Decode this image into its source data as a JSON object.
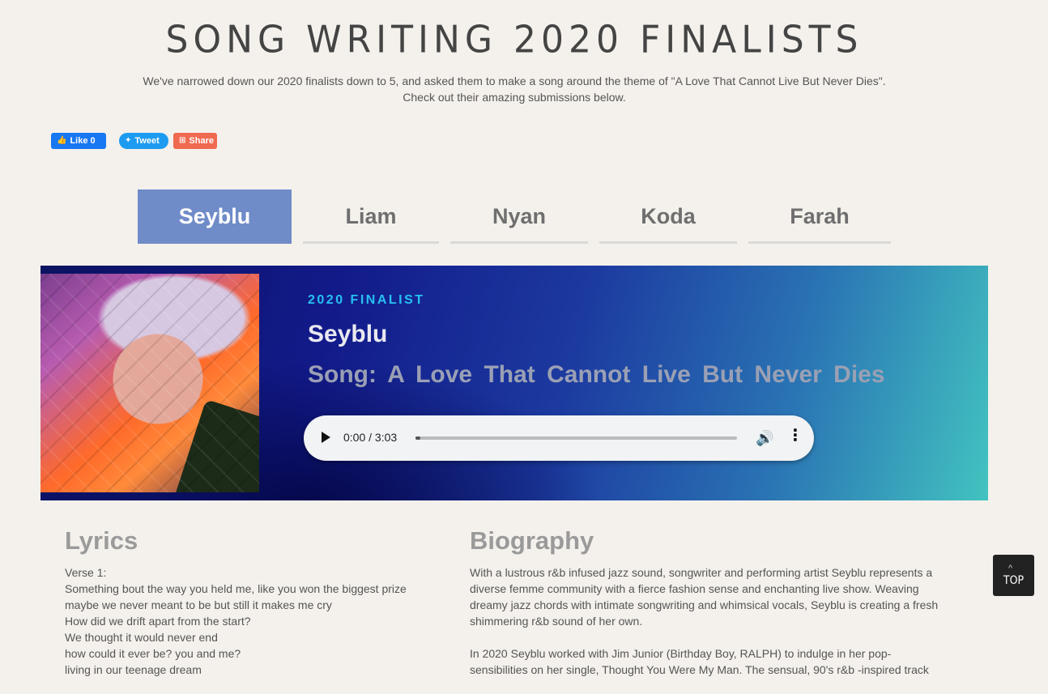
{
  "header": {
    "title": "SONG WRITING 2020 FINALISTS",
    "intro_line1": "We've narrowed down our 2020 finalists down to 5, and asked them to make a song around the theme of \"A Love That Cannot Live But Never Dies\".",
    "intro_line2": "Check out their amazing submissions below."
  },
  "social": {
    "like_label": "Like 0",
    "tweet_label": "Tweet",
    "share_label": "Share",
    "colors": {
      "facebook": "#1877f2",
      "twitter": "#1d9bf0",
      "share": "#f06a50"
    }
  },
  "tabs": [
    {
      "label": "Seyblu",
      "active": true
    },
    {
      "label": "Liam",
      "active": false
    },
    {
      "label": "Nyan",
      "active": false
    },
    {
      "label": "Koda",
      "active": false
    },
    {
      "label": "Farah",
      "active": false
    }
  ],
  "hero": {
    "kicker": "2020 FINALIST",
    "artist": "Seyblu",
    "song": "Song: A Love That Cannot Live But Never Dies",
    "player": {
      "time": "0:00 / 3:03",
      "progress_fraction": 0
    }
  },
  "lyrics": {
    "title": "Lyrics",
    "lines": [
      "Verse 1:",
      "Something bout the way you held me, like you won the biggest prize",
      "maybe we never meant to be but still it makes me cry",
      "How did we drift apart from the start?",
      "We thought it would never end",
      "how could it ever be? you and me?",
      "living in our teenage dream"
    ]
  },
  "biography": {
    "title": "Biography",
    "paragraphs": [
      "With a lustrous r&b infused jazz sound, songwriter and performing artist Seyblu represents a diverse femme community with a fierce fashion sense and enchanting live show. Weaving dreamy jazz chords with intimate songwriting and whimsical vocals, Seyblu is creating a fresh shimmering r&b sound of her own.",
      "In 2020 Seyblu worked with Jim Junior (Birthday Boy, RALPH) to indulge in her pop-sensibilities on her single, Thought You Were My Man. The sensual, 90's r&b -inspired track"
    ]
  },
  "top_button": {
    "label": "TOP",
    "arrow": "^"
  },
  "colors": {
    "accent_tab": "#6f8bc8",
    "kicker": "#27c1f2",
    "background": "#f4f1ec"
  }
}
